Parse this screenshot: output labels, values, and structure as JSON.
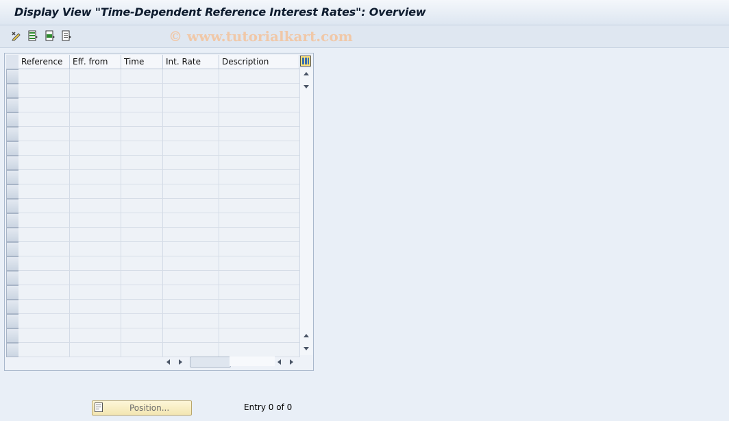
{
  "window": {
    "title": "Display View \"Time-Dependent Reference Interest Rates\": Overview"
  },
  "watermark": "© www.tutorialkart.com",
  "toolbar": {
    "icons": [
      "change-display-icon",
      "select-all-icon",
      "select-block-icon",
      "deselect-all-icon"
    ]
  },
  "table": {
    "columns": [
      "Reference",
      "Eff. from",
      "Time",
      "Int. Rate",
      "Description"
    ],
    "rows": [],
    "visible_row_count": 20
  },
  "footer": {
    "position_button": "Position...",
    "entry_text": "Entry 0 of 0"
  },
  "colors": {
    "background": "#e9eff7",
    "accent_button": "#f3e6b2"
  }
}
